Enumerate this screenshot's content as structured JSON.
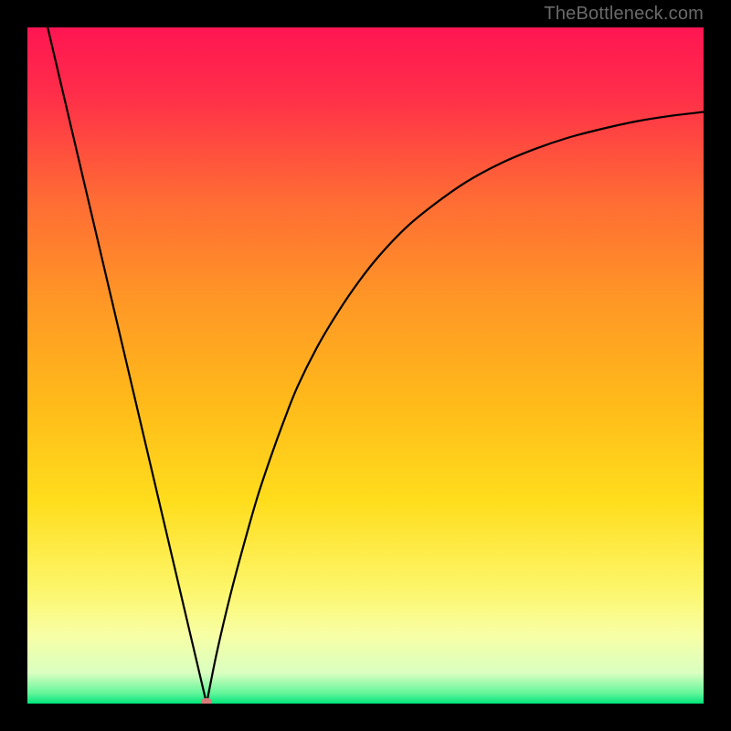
{
  "watermark": {
    "text": "TheBottleneck.com"
  },
  "colors": {
    "frame": "#000000",
    "curve": "#000000",
    "gradient_stops": [
      {
        "pos": 0.0,
        "color": "#ff1552"
      },
      {
        "pos": 0.1,
        "color": "#ff2e49"
      },
      {
        "pos": 0.25,
        "color": "#ff6a35"
      },
      {
        "pos": 0.4,
        "color": "#ff9626"
      },
      {
        "pos": 0.55,
        "color": "#ffb91a"
      },
      {
        "pos": 0.7,
        "color": "#ffdd1c"
      },
      {
        "pos": 0.83,
        "color": "#fdf66a"
      },
      {
        "pos": 0.9,
        "color": "#f7ffa6"
      },
      {
        "pos": 0.955,
        "color": "#d9ffc0"
      },
      {
        "pos": 0.985,
        "color": "#62f59a"
      },
      {
        "pos": 1.0,
        "color": "#00e47a"
      }
    ],
    "marker": "#d87a7a"
  },
  "chart_data": {
    "type": "line",
    "title": "",
    "xlabel": "",
    "ylabel": "",
    "xlim": [
      0,
      100
    ],
    "ylim": [
      0,
      100
    ],
    "grid": false,
    "legend": false,
    "left_branch": {
      "x": [
        3.0,
        26.5
      ],
      "y": [
        100.0,
        0.0
      ]
    },
    "right_branch_x": [
      26.5,
      28,
      30,
      32,
      34,
      36,
      38,
      40,
      43,
      46,
      49,
      52,
      56,
      60,
      65,
      70,
      75,
      80,
      85,
      90,
      95,
      100
    ],
    "right_branch_y": [
      0.0,
      7.5,
      16.0,
      23.5,
      30.5,
      36.5,
      42.0,
      47.0,
      53.0,
      58.0,
      62.4,
      66.2,
      70.4,
      73.7,
      77.2,
      79.9,
      82.0,
      83.7,
      85.0,
      86.1,
      86.9,
      87.5
    ],
    "minimum_marker": {
      "x": 26.5,
      "y": 0.0
    }
  }
}
